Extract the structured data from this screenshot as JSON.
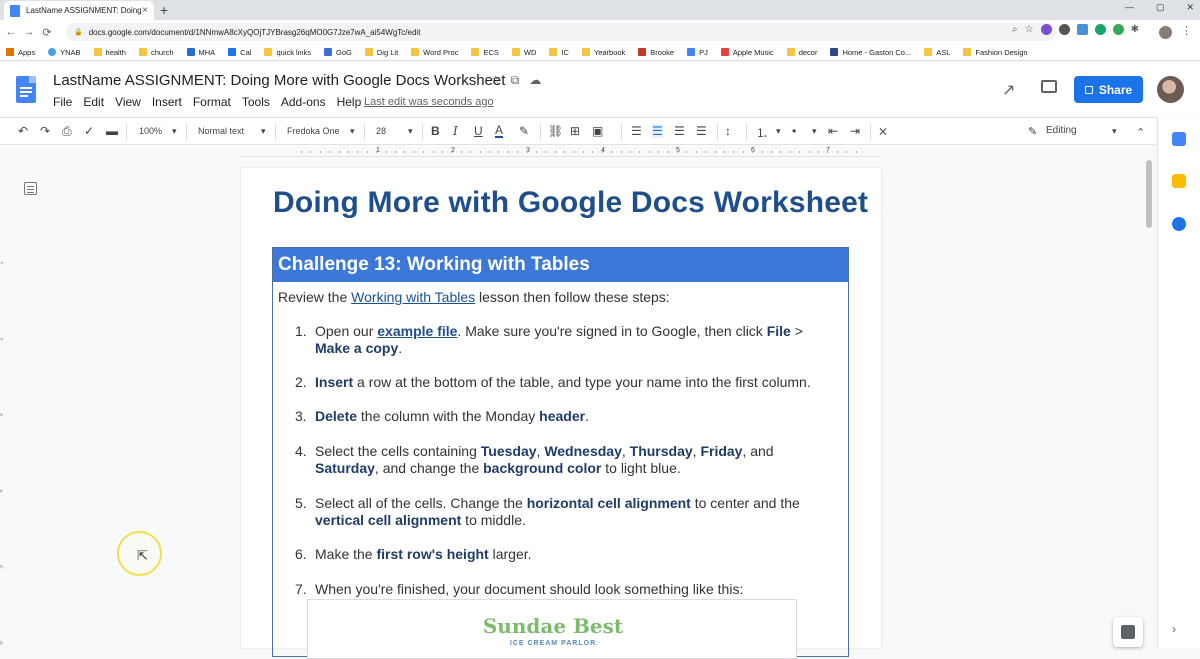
{
  "browser": {
    "tab_title": "LastName ASSIGNMENT: Doing",
    "tab_close": "×",
    "new_tab": "+",
    "url": "docs.google.com/document/d/1NNmwA8cXyQOjTJYBrasg26qMO0G7Jze7wA_ai54WgTc/edit",
    "window_controls": [
      "—",
      "▢",
      "✕"
    ],
    "bookmarks": [
      "Apps",
      "YNAB",
      "health",
      "church",
      "MHA",
      "Cal",
      "quick links",
      "GoG",
      "Dig Lit",
      "Word Proc",
      "ECS",
      "WD",
      "IC",
      "Yearbook",
      "Brooke",
      "PJ",
      "Apple Music",
      "decor",
      "Home - Gaston Co...",
      "ASL",
      "Fashion Design"
    ]
  },
  "docs": {
    "title": "LastName ASSIGNMENT: Doing More with Google Docs Worksheet",
    "menu": [
      "File",
      "Edit",
      "View",
      "Insert",
      "Format",
      "Tools",
      "Add-ons",
      "Help"
    ],
    "last_edit": "Last edit was seconds ago",
    "share_label": "Share"
  },
  "toolbar": {
    "zoom": "100%",
    "style": "Normal text",
    "font": "Fredoka One",
    "size": "28",
    "mode": "Editing"
  },
  "ruler": {
    "numbers": [
      "1",
      "2",
      "3",
      "4",
      "5",
      "6",
      "7"
    ]
  },
  "document": {
    "heading": "Doing More with Google Docs Worksheet",
    "table_header": "Challenge 13: Working with Tables",
    "intro_before": "Review the ",
    "intro_link": "Working with Tables",
    "intro_after": " lesson then follow these steps:",
    "steps": [
      {
        "n": "1.",
        "a": "Open our ",
        "link": "example file",
        "b": ". Make sure you're signed in to Google, then click ",
        "bold1": "File",
        "c": " > ",
        "bold2": "Make a copy",
        "d": "."
      },
      {
        "n": "2.",
        "bold1": "Insert",
        "a": " a row at the bottom of the table, and type your name into the first column."
      },
      {
        "n": "3.",
        "bold1": "Delete",
        "a": " the column with the Monday ",
        "bold2": "header",
        "b": "."
      },
      {
        "n": "4.",
        "a": "Select the cells containing ",
        "bold1": "Tuesday",
        "b": ", ",
        "bold2": "Wednesday",
        "c": ", ",
        "bold3": "Thursday",
        "d": ", ",
        "bold4": "Friday",
        "e": ", and ",
        "bold5": "Saturday",
        "f": ", and change the ",
        "bold6": "background color",
        "g": " to light blue."
      },
      {
        "n": "5.",
        "a": "Select all of the cells. Change the ",
        "bold1": "horizontal cell alignment",
        "b": " to center and the ",
        "bold2": "vertical cell alignment",
        "c": " to middle."
      },
      {
        "n": "6.",
        "a": "Make the ",
        "bold1": "first row's height",
        "b": " larger."
      },
      {
        "n": "7.",
        "a": "When you're finished, your document should look something like this:"
      }
    ],
    "sample_title": "Sundae Best",
    "sample_subtitle": "ICE CREAM PARLOR"
  },
  "colors": {
    "accent": "#1a73e8",
    "heading": "#1f4e8c",
    "table_header_bg": "#3c78d8"
  }
}
